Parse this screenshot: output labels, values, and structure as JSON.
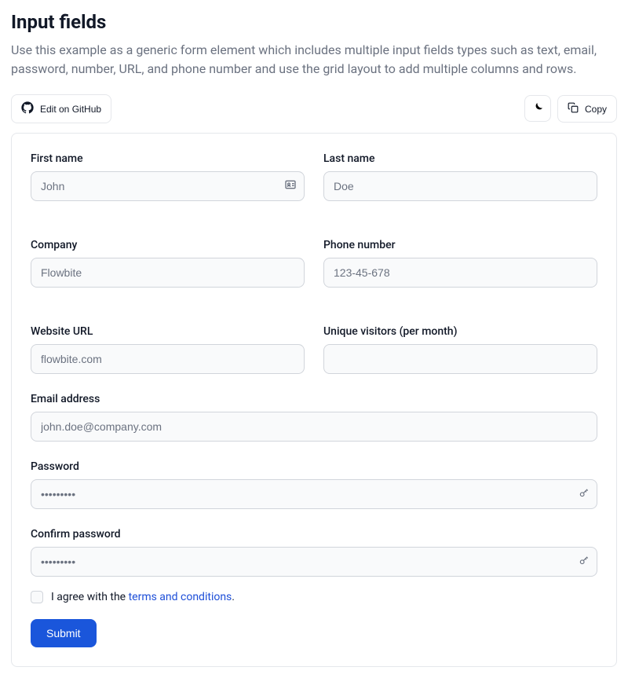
{
  "page": {
    "title": "Input fields",
    "description": "Use this example as a generic form element which includes multiple input fields types such as text, email, password, number, URL, and phone number and use the grid layout to add multiple columns and rows."
  },
  "toolbar": {
    "edit_label": "Edit on GitHub",
    "copy_label": "Copy"
  },
  "form": {
    "first_name": {
      "label": "First name",
      "placeholder": "John"
    },
    "last_name": {
      "label": "Last name",
      "placeholder": "Doe"
    },
    "company": {
      "label": "Company",
      "placeholder": "Flowbite"
    },
    "phone": {
      "label": "Phone number",
      "placeholder": "123-45-678"
    },
    "website": {
      "label": "Website URL",
      "placeholder": "flowbite.com"
    },
    "visitors": {
      "label": "Unique visitors (per month)",
      "placeholder": ""
    },
    "email": {
      "label": "Email address",
      "placeholder": "john.doe@company.com"
    },
    "password": {
      "label": "Password",
      "placeholder": "•••••••••"
    },
    "confirm": {
      "label": "Confirm password",
      "placeholder": "•••••••••"
    },
    "terms": {
      "prefix": "I agree with the ",
      "link": "terms and conditions",
      "suffix": "."
    },
    "submit_label": "Submit"
  }
}
